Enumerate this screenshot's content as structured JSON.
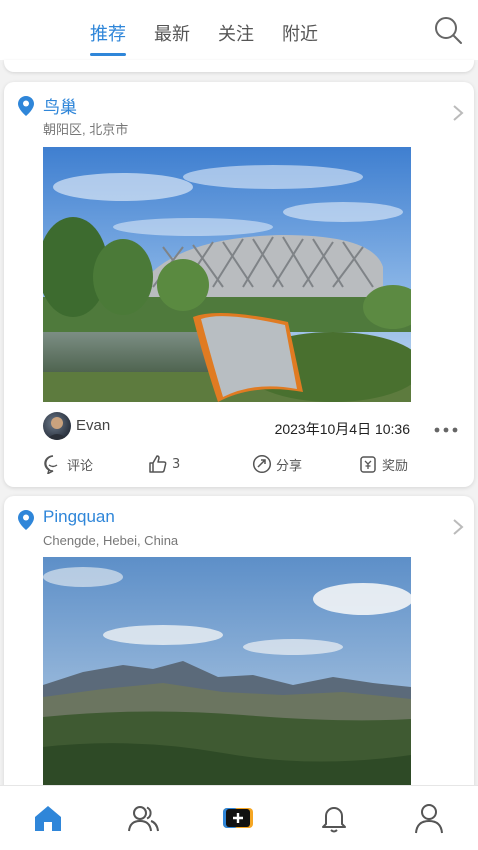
{
  "tabs": [
    {
      "label": "推荐",
      "active": true
    },
    {
      "label": "最新",
      "active": false
    },
    {
      "label": "关注",
      "active": false
    },
    {
      "label": "附近",
      "active": false
    }
  ],
  "icons": {
    "search": "search-icon",
    "location": "location-pin-icon",
    "chevron": "chevron-right-icon",
    "more": "more-horizontal-icon",
    "comment": "comment-icon",
    "like": "thumbs-up-icon",
    "share": "share-icon",
    "reward": "reward-icon",
    "nav": [
      "home-icon",
      "friends-icon",
      "create-post-icon",
      "notifications-icon",
      "profile-icon"
    ]
  },
  "colors": {
    "accent": "#2f86d9",
    "create_orange": "#f5a623",
    "create_blue": "#2f86d9"
  },
  "posts": [
    {
      "place": "鸟巢",
      "location": "朝阳区, 北京市",
      "author": "Evan",
      "datetime": "2023年10月4日 10:36",
      "actions": {
        "comment": "评论",
        "likes": "3",
        "share": "分享",
        "reward": "奖励"
      }
    },
    {
      "place": "Pingquan",
      "location": "Chengde, Hebei, China"
    }
  ]
}
